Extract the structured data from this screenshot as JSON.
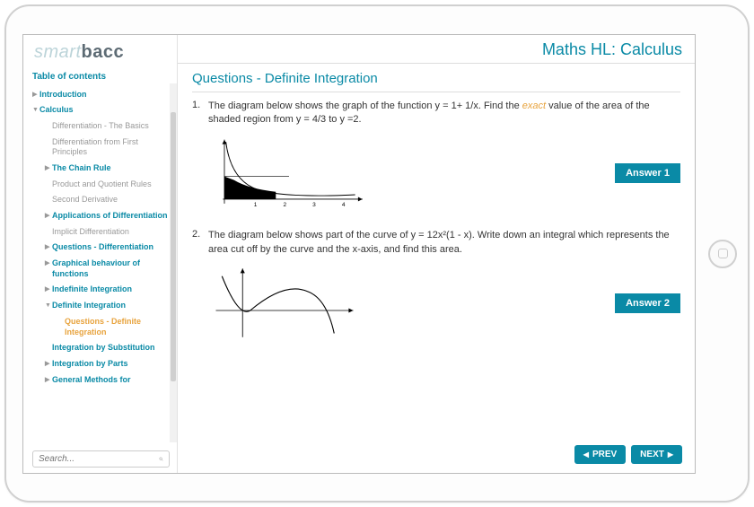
{
  "logo": {
    "part1": "smart",
    "part2": "bacc"
  },
  "header": {
    "title": "Maths HL: Calculus"
  },
  "toc_title": "Table of contents",
  "sidebar": {
    "items": [
      {
        "label": "Introduction",
        "level": 0,
        "caret": "right",
        "bold": true
      },
      {
        "label": "Calculus",
        "level": 1,
        "caret": "down",
        "bold": true
      },
      {
        "label": "Differentiation - The Basics",
        "level": 2
      },
      {
        "label": "Differentiation from First Principles",
        "level": 2
      },
      {
        "label": "The Chain Rule",
        "level": 2,
        "caret": "right",
        "bold": true
      },
      {
        "label": "Product and Quotient Rules",
        "level": 2
      },
      {
        "label": "Second Derivative",
        "level": 2
      },
      {
        "label": "Applications of Differentiation",
        "level": 2,
        "caret": "right",
        "bold": true
      },
      {
        "label": "Implicit Differentiation",
        "level": 2
      },
      {
        "label": "Questions - Differentiation",
        "level": 2,
        "caret": "right",
        "bold": true
      },
      {
        "label": "Graphical behaviour of functions",
        "level": 2,
        "caret": "right",
        "bold": true
      },
      {
        "label": "Indefinite Integration",
        "level": 2,
        "caret": "right",
        "bold": true
      },
      {
        "label": "Definite Integration",
        "level": 2,
        "caret": "down",
        "bold": true
      },
      {
        "label": "Questions - Definite Integration",
        "level": 3,
        "active": true
      },
      {
        "label": "Integration by Substitution",
        "level": 2,
        "bold": true
      },
      {
        "label": "Integration by Parts",
        "level": 2,
        "caret": "right",
        "bold": true
      },
      {
        "label": "General Methods for",
        "level": 2,
        "caret": "right",
        "bold": true
      }
    ]
  },
  "search": {
    "placeholder": "Search..."
  },
  "section_title": "Questions - Definite Integration",
  "questions": [
    {
      "num": "1.",
      "text_pre": "The diagram below shows the graph of the function y = 1+ 1/x.  Find the ",
      "text_em": "exact",
      "text_post": " value of the area of the shaded region from y = 4/3 to y =2.",
      "answer": "Answer 1"
    },
    {
      "num": "2.",
      "text_pre": "The diagram below shows part of the curve of y = 12x²(1 - x).  Write down an integral which represents the area cut off by the curve and the x-axis, and find this area.",
      "text_em": "",
      "text_post": "",
      "answer": "Answer 2"
    }
  ],
  "nav": {
    "prev": "PREV",
    "next": "NEXT"
  }
}
